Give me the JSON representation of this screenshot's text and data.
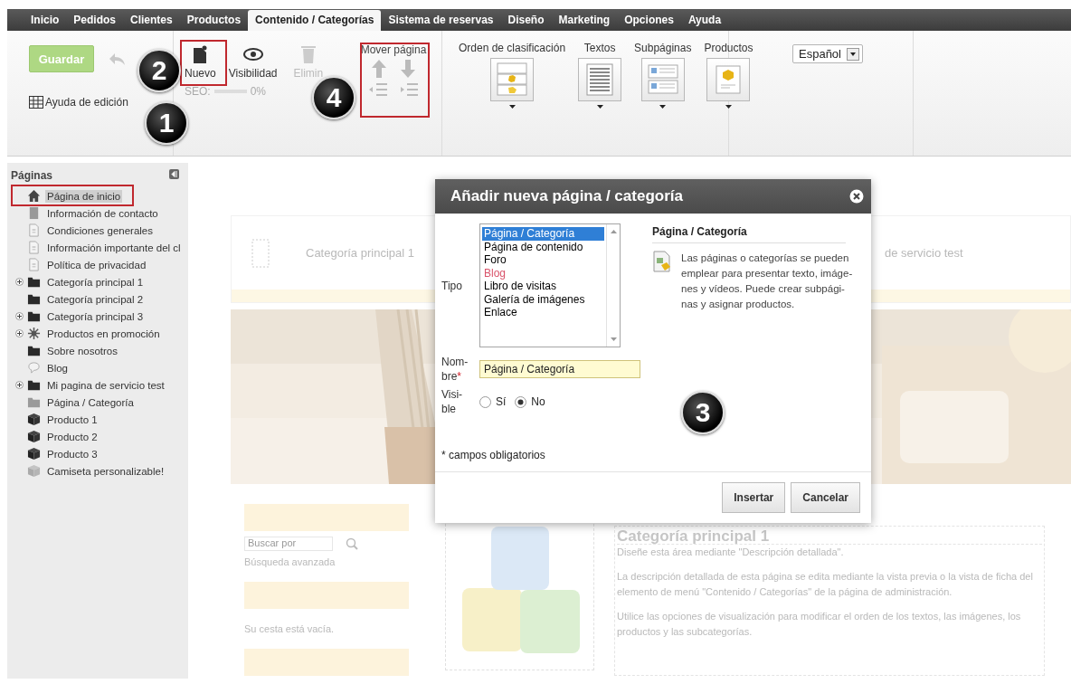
{
  "nav": {
    "tabs": [
      {
        "label": "Inicio",
        "selected": false
      },
      {
        "label": "Pedidos",
        "selected": false
      },
      {
        "label": "Clientes",
        "selected": false
      },
      {
        "label": "Productos",
        "selected": false
      },
      {
        "label": "Contenido / Categorías",
        "selected": true
      },
      {
        "label": "Sistema de reservas",
        "selected": false
      },
      {
        "label": "Diseño",
        "selected": false
      },
      {
        "label": "Marketing",
        "selected": false
      },
      {
        "label": "Opciones",
        "selected": false
      },
      {
        "label": "Ayuda",
        "selected": false
      }
    ]
  },
  "ribbon": {
    "save": {
      "label": "Guardar",
      "disabled": true
    },
    "help": "Ayuda de edición",
    "new": "Nuevo",
    "visibility": "Visibilidad",
    "delete": {
      "label": "Elimin",
      "disabled": true
    },
    "seo": {
      "label": "SEO:",
      "level": 0,
      "reading": "0%"
    },
    "move": "Mover página",
    "views": [
      {
        "label": "Orden de clasificación",
        "kind": "sort"
      },
      {
        "label": "Textos",
        "kind": "texts"
      },
      {
        "label": "Subpáginas",
        "kind": "subpages"
      },
      {
        "label": "Productos",
        "kind": "products"
      }
    ],
    "language": "Español"
  },
  "sidebar": {
    "title": "Páginas",
    "items": [
      {
        "label": "Página de inicio",
        "kind": "home",
        "selected": true
      },
      {
        "label": "Información de contacto",
        "kind": "page",
        "selected": false
      },
      {
        "label": "Condiciones generales",
        "kind": "doc",
        "selected": false
      },
      {
        "label": "Información importante del cl",
        "kind": "doc",
        "selected": false
      },
      {
        "label": "Política de privacidad",
        "kind": "doc",
        "selected": false
      },
      {
        "label": "Categoría principal 1",
        "kind": "folder",
        "selected": false,
        "expanded": false
      },
      {
        "label": "Categoría principal 2",
        "kind": "folder",
        "selected": false
      },
      {
        "label": "Categoría principal 3",
        "kind": "folder",
        "selected": false,
        "expanded": false
      },
      {
        "label": "Productos en promoción",
        "kind": "star",
        "selected": false,
        "expanded": false
      },
      {
        "label": "Sobre nosotros",
        "kind": "folder",
        "selected": false
      },
      {
        "label": "Blog",
        "kind": "blog",
        "selected": false
      },
      {
        "label": "Mi pagina de servicio test",
        "kind": "folder",
        "selected": false,
        "expanded": false
      },
      {
        "label": "Página / Categoría",
        "kind": "folder-faded",
        "selected": false
      },
      {
        "label": "Producto 1",
        "kind": "product",
        "selected": false
      },
      {
        "label": "Producto 2",
        "kind": "product",
        "selected": false
      },
      {
        "label": "Producto 3",
        "kind": "product",
        "selected": false
      },
      {
        "label": "Camiseta personalizable!",
        "kind": "product-faded",
        "selected": false
      }
    ]
  },
  "preview": {
    "menu": [
      "Categoría principal 1",
      "de servicio test"
    ],
    "search": {
      "placeholder": "Buscar por"
    },
    "advanced_search": "Búsqueda avanzada",
    "cart": "Su cesta está vacía.",
    "heading": "Categoría principal 1",
    "paragraphs": [
      "Diseñe esta área mediante \"Descripción detallada\".",
      "La descripción detallada de esta página se edita mediante la vista previa o la vista de ficha del elemento de menú \"Contenido / Categorías\" de la página de administración.",
      "Utilice las opciones de visualización para modificar el orden de los textos, las imágenes, los productos y las subcategorías."
    ]
  },
  "dialog": {
    "title": "Añadir nueva página / categoría",
    "type_label": "Tipo",
    "types": [
      {
        "label": "Página / Categoría",
        "selected": true
      },
      {
        "label": "Página de contenido",
        "selected": false,
        "color": "#000000"
      },
      {
        "label": "Foro",
        "selected": false,
        "color": "#000000"
      },
      {
        "label": "Blog",
        "selected": false,
        "color": "#d9536a"
      },
      {
        "label": "Libro de visitas",
        "selected": false,
        "color": "#000000"
      },
      {
        "label": "Galería de imágenes",
        "selected": false,
        "color": "#000000"
      },
      {
        "label": "Enlace",
        "selected": false,
        "color": "#000000"
      }
    ],
    "info_title": "Página / Categoría",
    "info_text": "Las páginas o categorías se pueden emplear para presentar texto, imáge-nes y vídeos. Puede crear subpági-nas y asignar productos.",
    "name_label": [
      "Nom-",
      "bre"
    ],
    "required_mark": "*",
    "name_value": "Página / Categoría",
    "visible_label": [
      "Visi-",
      "ble"
    ],
    "visible_options": [
      {
        "label": "Sí",
        "selected": false
      },
      {
        "label": "No",
        "selected": true
      }
    ],
    "footnote": "* campos obligatorios",
    "buttons": [
      "Insertar",
      "Cancelar"
    ]
  },
  "callouts": [
    "1",
    "2",
    "3",
    "4"
  ]
}
